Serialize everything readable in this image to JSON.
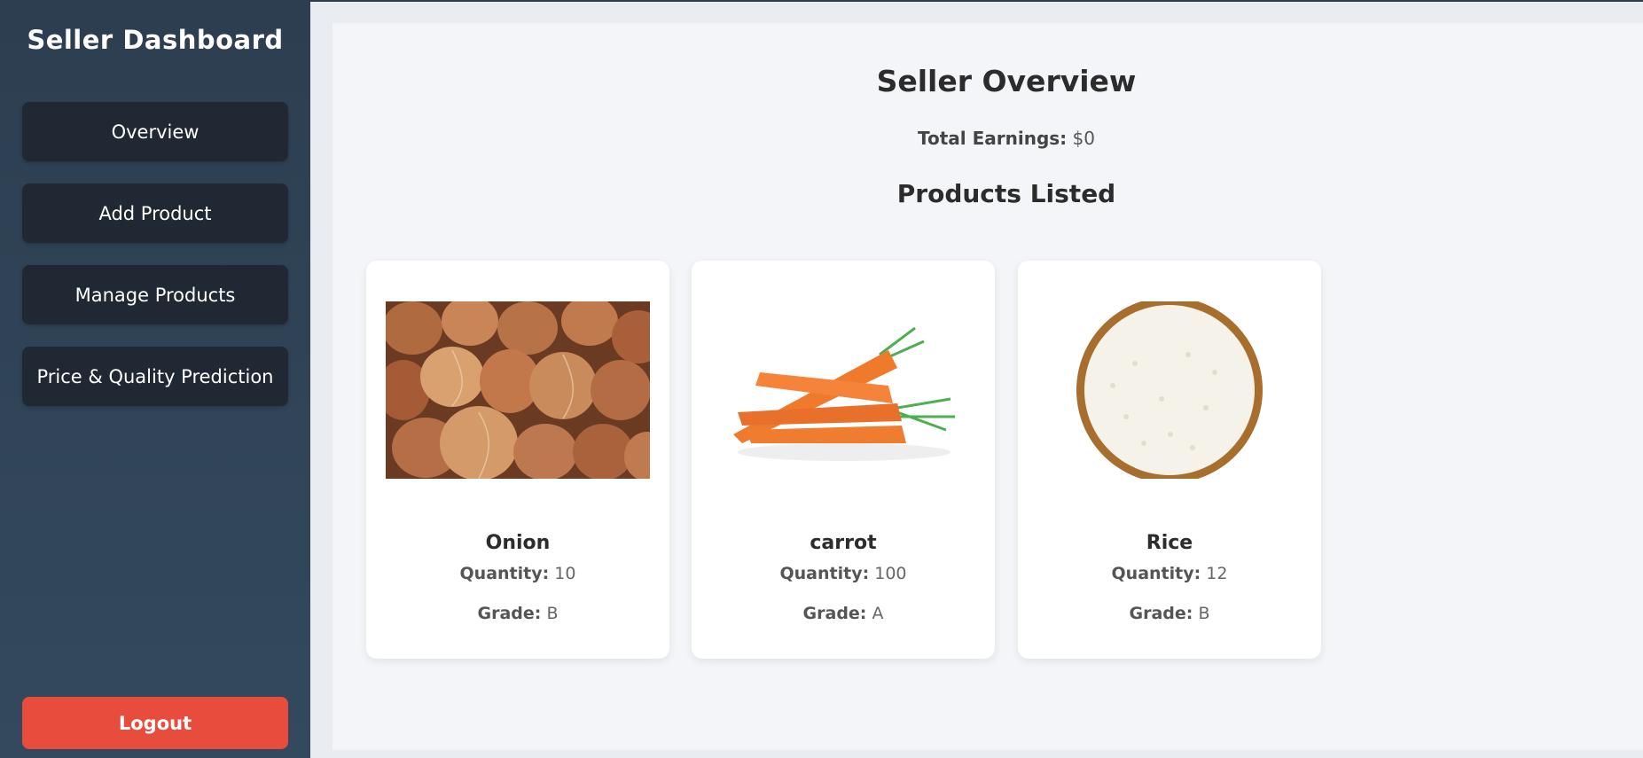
{
  "sidebar": {
    "title": "Seller Dashboard",
    "nav": [
      {
        "label": "Overview"
      },
      {
        "label": "Add Product"
      },
      {
        "label": "Manage Products"
      },
      {
        "label": "Price & Quality Prediction"
      }
    ],
    "logout_label": "Logout"
  },
  "main": {
    "title": "Seller Overview",
    "earnings_label": "Total Earnings:",
    "earnings_value": "$0",
    "products_title": "Products Listed",
    "products": [
      {
        "name": "Onion",
        "quantity_label": "Quantity:",
        "quantity": "10",
        "grade_label": "Grade:",
        "grade": "B",
        "image": "onion-photo"
      },
      {
        "name": "carrot",
        "quantity_label": "Quantity:",
        "quantity": "100",
        "grade_label": "Grade:",
        "grade": "A",
        "image": "carrot-photo"
      },
      {
        "name": "Rice",
        "quantity_label": "Quantity:",
        "quantity": "12",
        "grade_label": "Grade:",
        "grade": "B",
        "image": "rice-bowl-photo"
      }
    ]
  },
  "colors": {
    "sidebar_bg": "#2d3e50",
    "nav_button_bg": "#1f2833",
    "logout_bg": "#e74c3c",
    "main_bg": "#f3f5f8"
  }
}
